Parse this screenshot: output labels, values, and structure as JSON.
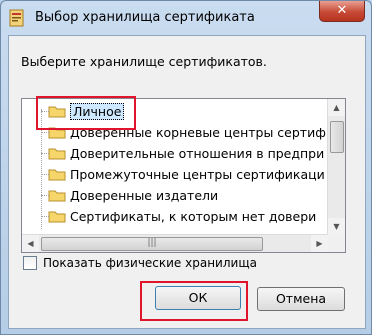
{
  "window": {
    "title": "Выбор хранилища сертификата",
    "close_label": "✕"
  },
  "prompt": "Выберите хранилище сертификатов.",
  "tree": {
    "items": [
      {
        "label": "Личное",
        "selected": true
      },
      {
        "label": "Доверенные корневые центры сертиф"
      },
      {
        "label": "Доверительные отношения в предпри"
      },
      {
        "label": "Промежуточные центры сертификаци"
      },
      {
        "label": "Доверенные издатели"
      },
      {
        "label": "Сертификаты, к которым нет довери"
      }
    ]
  },
  "checkbox": {
    "label": "Показать физические хранилища",
    "checked": false
  },
  "buttons": {
    "ok": "ОК",
    "cancel": "Отмена"
  },
  "colors": {
    "highlight": "#e0142a",
    "selection": "#cde8ff"
  }
}
